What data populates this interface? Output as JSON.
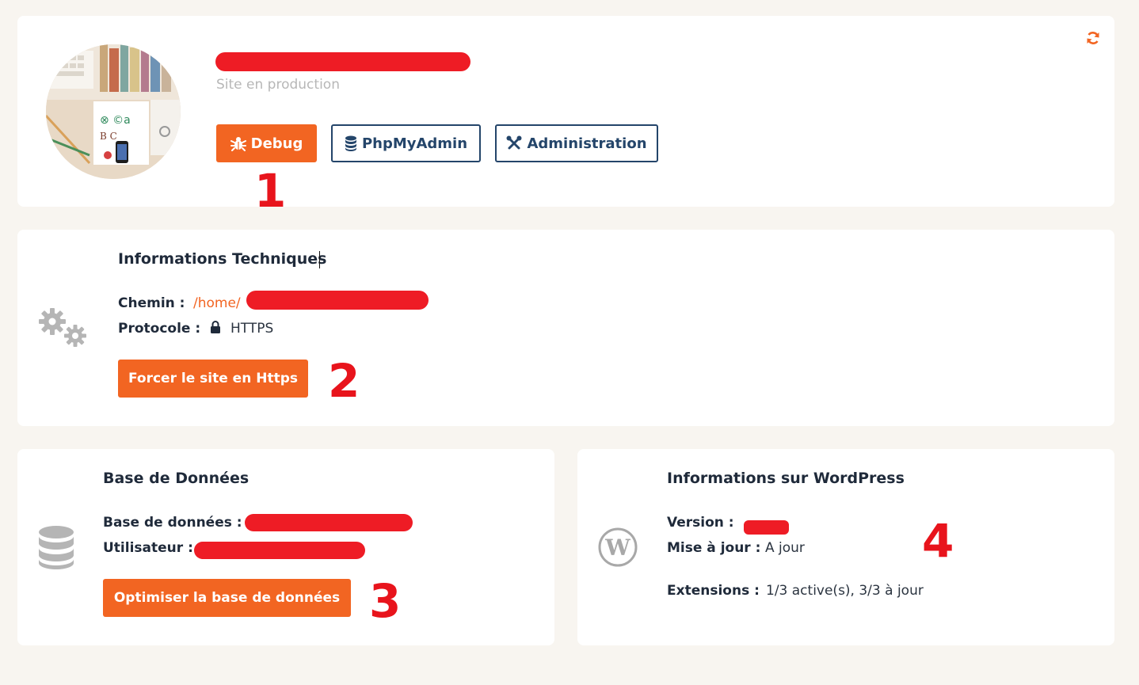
{
  "site": {
    "subtitle": "Site en production",
    "buttons": {
      "debug": "Debug",
      "phpmyadmin": "PhpMyAdmin",
      "administration": "Administration"
    }
  },
  "tech": {
    "title": "Informations Techniques",
    "chemin_label": "Chemin :",
    "chemin_value": "/home/",
    "protocole_label": "Protocole :",
    "protocole_value": "HTTPS",
    "button": "Forcer le site en Https"
  },
  "db": {
    "title": "Base de Données",
    "database_label": "Base de données :",
    "user_label": "Utilisateur :",
    "button": "Optimiser la base de données"
  },
  "wp": {
    "title": "Informations sur WordPress",
    "version_label": "Version :",
    "update_label": "Mise à jour :",
    "update_value": "A jour",
    "extensions_label": "Extensions :",
    "extensions_value": "1/3 active(s), 3/3 à jour"
  },
  "annotations": [
    "1",
    "2",
    "3",
    "4"
  ],
  "icons": {
    "refresh": "refresh-icon",
    "debug": "bug-icon",
    "phpmyadmin": "database-icon",
    "administration": "tools-icon",
    "tech": "gears-icon",
    "lock": "lock-icon",
    "db": "database-stack-icon",
    "wp": "wordpress-icon"
  },
  "colors": {
    "accent": "#f26522",
    "navy": "#24456a",
    "redaction": "#ee1c25",
    "background": "#f8f5f0"
  }
}
